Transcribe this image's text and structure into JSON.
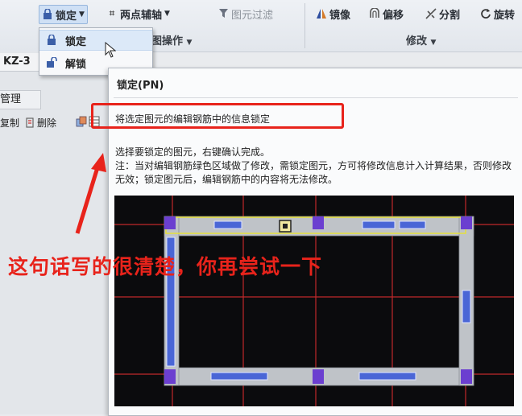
{
  "ribbon": {
    "lock_label": "锁定",
    "two_point_axis_label": "两点辅轴",
    "element_filter_label": "图元过滤",
    "mirror_label": "镜像",
    "offset_label": "偏移",
    "split_label": "分割",
    "rotate_label": "旋转",
    "operation_group_label": "图操作",
    "modify_group_label": "修改"
  },
  "lock_menu": {
    "lock_item": "锁定",
    "unlock_item": "解锁"
  },
  "left_panel": {
    "element_tab": "KZ-3",
    "management_tab": "管理",
    "copy_label": "复制",
    "delete_label": "删除"
  },
  "tooltip": {
    "title": "锁定(PN)",
    "description": "将选定图元的编辑钢筋中的信息锁定",
    "usage": "选择要锁定的图元，右键确认完成。",
    "note": "注：当对编辑钢筋绿色区域做了修改，需锁定图元，方可将修改信息计入计算结果，否则修改无效；锁定图元后，编辑钢筋中的内容将无法修改。"
  },
  "annotation": {
    "text": "这句话写的很清楚，你再尝试一下",
    "color": "#e8231b"
  },
  "colors": {
    "grid_line": "#c0282b",
    "beam_fill": "#bfc3c8",
    "rebar_blue": "#4a66d6",
    "highlight_yellow": "#e6e03a",
    "column_purple": "#6b3fd0"
  }
}
